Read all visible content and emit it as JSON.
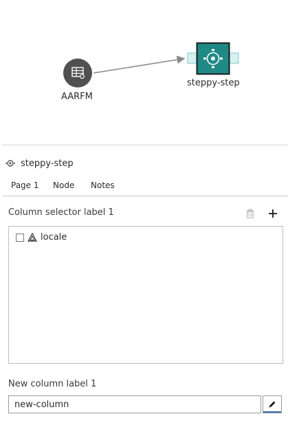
{
  "canvas": {
    "source_node": {
      "label": "AARFM",
      "icon": "table-icon"
    },
    "target_node": {
      "label": "steppy-step",
      "icon": "eye-icon"
    },
    "colors": {
      "source_fill": "#505050",
      "target_fill": "#1f8a85",
      "port_fill": "#d6f1f1",
      "port_stroke": "#7fcfd0",
      "edge": "#8a8a8a"
    }
  },
  "panel": {
    "title": "steppy-step",
    "tabs": [
      {
        "label": "Page 1",
        "active": true
      },
      {
        "label": "Node",
        "active": false
      },
      {
        "label": "Notes",
        "active": false
      }
    ],
    "column_selector": {
      "label": "Column selector label 1",
      "items": [
        {
          "name": "locale",
          "checked": false,
          "type_icon": "string-type-icon"
        }
      ]
    },
    "new_column": {
      "label": "New column label 1",
      "value": "new-column"
    }
  }
}
